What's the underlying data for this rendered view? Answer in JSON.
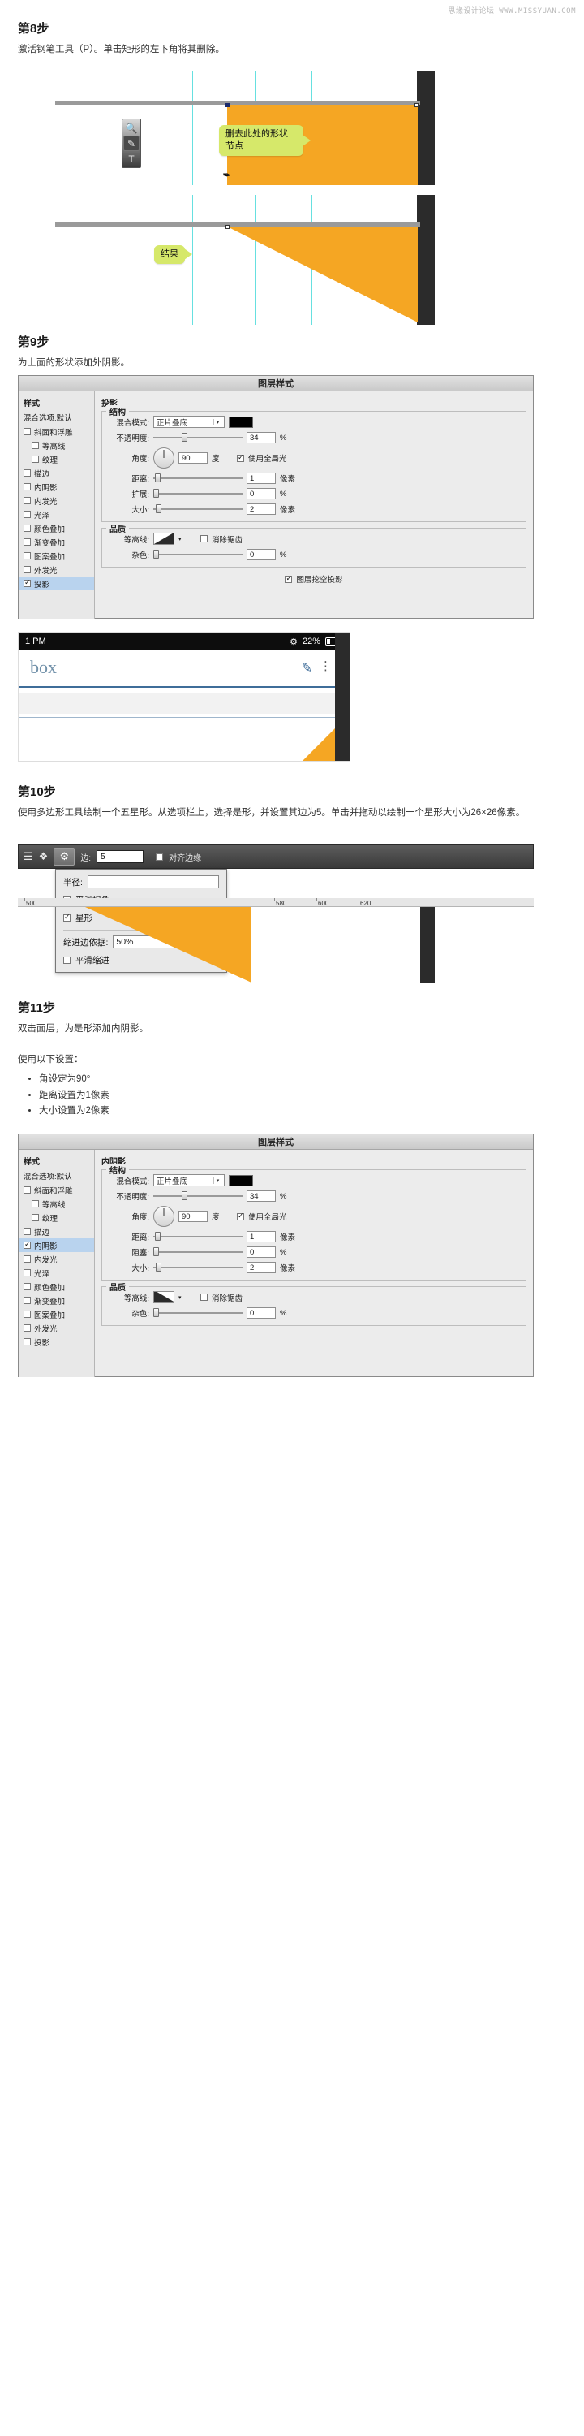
{
  "watermark": "思缘设计论坛 WWW.MISSYUAN.COM",
  "steps": [
    {
      "title": "第8步",
      "desc": "激活钢笔工具（P）。单击矩形的左下角将其删除。",
      "callouts": [
        "删去此处的形状\n节点"
      ]
    },
    {
      "title": "第9步",
      "desc": "为上面的形状添加外阴影。",
      "callouts": [
        "结果"
      ]
    },
    {
      "title": "第10步",
      "desc": "使用多边形工具绘制一个五星形。从选项栏上，选择是形，并设置其边为5。单击并拖动以绘制一个星形大小为26×26像素。"
    },
    {
      "title": "第11步",
      "desc": "双击面层，为是形添加内阴影。",
      "intro": "使用以下设置：",
      "tips": [
        "角设定为90°",
        "距离设置为1像素",
        "大小设置为2像素"
      ]
    }
  ],
  "callout_result": "结果",
  "callout_delete_line1": "删去此处的形状",
  "callout_delete_line2": "节点",
  "drop_shadow_dialog": {
    "title": "图层样式",
    "left": {
      "styles_header": "样式",
      "blend_options": "混合选项:默认",
      "items": [
        {
          "label": "斜面和浮雕",
          "checked": false,
          "indent": false,
          "active": false
        },
        {
          "label": "等高线",
          "checked": false,
          "indent": true,
          "active": false
        },
        {
          "label": "纹理",
          "checked": false,
          "indent": true,
          "active": false
        },
        {
          "label": "描边",
          "checked": false,
          "indent": false,
          "active": false
        },
        {
          "label": "内阴影",
          "checked": false,
          "indent": false,
          "active": false
        },
        {
          "label": "内发光",
          "checked": false,
          "indent": false,
          "active": false
        },
        {
          "label": "光泽",
          "checked": false,
          "indent": false,
          "active": false
        },
        {
          "label": "颜色叠加",
          "checked": false,
          "indent": false,
          "active": false
        },
        {
          "label": "渐变叠加",
          "checked": false,
          "indent": false,
          "active": false
        },
        {
          "label": "图案叠加",
          "checked": false,
          "indent": false,
          "active": false
        },
        {
          "label": "外发光",
          "checked": false,
          "indent": false,
          "active": false
        },
        {
          "label": "投影",
          "checked": true,
          "indent": false,
          "active": true
        }
      ]
    },
    "section_title": "投影",
    "structure_label": "结构",
    "quality_label": "品质",
    "rows": {
      "blend_mode_label": "混合模式:",
      "blend_mode_value": "正片叠底",
      "blend_color": "#000000",
      "opacity_label": "不透明度:",
      "opacity_value": "34",
      "opacity_unit": "%",
      "angle_label": "角度:",
      "angle_value": "90",
      "angle_unit": "度",
      "global_light_label": "使用全局光",
      "global_light_checked": true,
      "distance_label": "距离:",
      "distance_value": "1",
      "distance_unit": "像素",
      "spread_label": "扩展:",
      "spread_value": "0",
      "spread_unit": "%",
      "size_label": "大小:",
      "size_value": "2",
      "size_unit": "像素",
      "contour_label": "等高线:",
      "antialias_label": "消除锯齿",
      "antialias_checked": false,
      "noise_label": "杂色:",
      "noise_value": "0",
      "noise_unit": "%",
      "knockout_label": "图层挖空投影",
      "knockout_checked": true
    }
  },
  "inner_shadow_dialog": {
    "title": "图层样式",
    "left": {
      "styles_header": "样式",
      "blend_options": "混合选项:默认",
      "items": [
        {
          "label": "斜面和浮雕",
          "checked": false,
          "indent": false,
          "active": false
        },
        {
          "label": "等高线",
          "checked": false,
          "indent": true,
          "active": false
        },
        {
          "label": "纹理",
          "checked": false,
          "indent": true,
          "active": false
        },
        {
          "label": "描边",
          "checked": false,
          "indent": false,
          "active": false
        },
        {
          "label": "内阴影",
          "checked": true,
          "indent": false,
          "active": true
        },
        {
          "label": "内发光",
          "checked": false,
          "indent": false,
          "active": false
        },
        {
          "label": "光泽",
          "checked": false,
          "indent": false,
          "active": false
        },
        {
          "label": "颜色叠加",
          "checked": false,
          "indent": false,
          "active": false
        },
        {
          "label": "渐变叠加",
          "checked": false,
          "indent": false,
          "active": false
        },
        {
          "label": "图案叠加",
          "checked": false,
          "indent": false,
          "active": false
        },
        {
          "label": "外发光",
          "checked": false,
          "indent": false,
          "active": false
        },
        {
          "label": "投影",
          "checked": false,
          "indent": false,
          "active": false
        }
      ]
    },
    "section_title": "内阴影",
    "structure_label": "结构",
    "quality_label": "品质",
    "rows": {
      "blend_mode_label": "混合模式:",
      "blend_mode_value": "正片叠底",
      "blend_color": "#000000",
      "opacity_label": "不透明度:",
      "opacity_value": "34",
      "opacity_unit": "%",
      "angle_label": "角度:",
      "angle_value": "90",
      "angle_unit": "度",
      "global_light_label": "使用全局光",
      "global_light_checked": true,
      "distance_label": "距离:",
      "distance_value": "1",
      "distance_unit": "像素",
      "choke_label": "阻塞:",
      "choke_value": "0",
      "choke_unit": "%",
      "size_label": "大小:",
      "size_value": "2",
      "size_unit": "像素",
      "contour_label": "等高线:",
      "antialias_label": "消除锯齿",
      "antialias_checked": false,
      "noise_label": "杂色:",
      "noise_value": "0",
      "noise_unit": "%"
    }
  },
  "mobile_mock": {
    "time": "1 PM",
    "battery_text": "22%",
    "bluetooth_icon": "bluetooth-icon",
    "app_title": "box",
    "compose_icon": "compose-icon",
    "overflow_icon": "overflow-menu-icon"
  },
  "options_bar": {
    "align_icon": "align-icon",
    "layers_icon": "layers-icon",
    "gear_icon": "gear-icon",
    "sides_label": "边:",
    "sides_value": "5",
    "snap_label": "对齐边缘",
    "snap_checked": false
  },
  "polygon_popover": {
    "radius_label": "半径:",
    "radius_value": "",
    "smooth_corners_label": "平滑拐角",
    "smooth_corners_checked": false,
    "star_label": "星形",
    "star_checked": true,
    "indent_label": "缩进边依据:",
    "indent_value": "50%",
    "smooth_indent_label": "平滑缩进",
    "smooth_indent_checked": false
  },
  "ruler_marks": [
    "500",
    "580",
    "600",
    "620"
  ],
  "colors": {
    "orange": "#f5a623",
    "callout_green": "#d6e86a",
    "guide_cyan": "#66e0e0",
    "dark": "#2b2b2b",
    "ruler_grey": "#9a9a9a",
    "accent_blue": "#3f6d99"
  }
}
